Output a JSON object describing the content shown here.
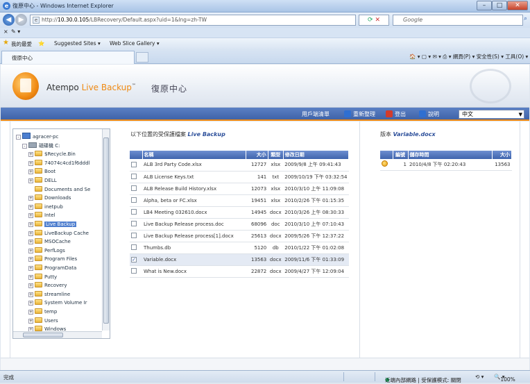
{
  "window": {
    "title": "復原中心 - Windows Internet Explorer",
    "min": "–",
    "max": "□",
    "close": "✕"
  },
  "address": {
    "prefix": "http://",
    "host": "10.30.0.105",
    "path": "/LBRecovery/Default.aspx?uid=1&lng=zh-TW",
    "search_placeholder": "Google",
    "refresh": "✕"
  },
  "menu": {
    "close_x": "×",
    "fav_tool": "✎ ▾"
  },
  "favorites": {
    "label": "我的最愛",
    "suggested": "Suggested Sites ▾",
    "gallery": "Web Slice Gallery ▾"
  },
  "tab": {
    "label": "復原中心"
  },
  "commands": {
    "text": "🏠 ▾  ▢ ▾  ✉ ▾  ⎙ ▾  網頁(P) ▾  安全性(S) ▾  工具(O) ▾  ❓ ▾"
  },
  "app": {
    "brand_main": "Atempo",
    "brand_product": "Live Backup",
    "brand_tm": "™",
    "page_title": "復原中心"
  },
  "toolbar": {
    "client_label": "用戶端清單",
    "refresh_label": "重新整理",
    "logout_label": "登出",
    "help_label": "說明",
    "language": "中文",
    "colors": {
      "refresh": "#2f6fd1",
      "logout": "#d23c2c",
      "help": "#2f6fd1"
    }
  },
  "tree": {
    "items": [
      {
        "label": "agracer-pc",
        "kind": "pc",
        "level": 0,
        "pm": "-"
      },
      {
        "label": "磁碟機 C:",
        "kind": "drive",
        "level": 1,
        "pm": "-"
      },
      {
        "label": "$Recycle.Bin",
        "kind": "folder",
        "level": 2,
        "pm": "+"
      },
      {
        "label": "74074c4cd1f6dddl",
        "kind": "folder",
        "level": 2,
        "pm": "+"
      },
      {
        "label": "Boot",
        "kind": "folder",
        "level": 2,
        "pm": "+"
      },
      {
        "label": "DELL",
        "kind": "folder",
        "level": 2,
        "pm": "+"
      },
      {
        "label": "Documents and Se",
        "kind": "folder",
        "level": 2,
        "pm": ""
      },
      {
        "label": "Downloads",
        "kind": "folder",
        "level": 2,
        "pm": "+"
      },
      {
        "label": "inetpub",
        "kind": "folder",
        "level": 2,
        "pm": "+"
      },
      {
        "label": "Intel",
        "kind": "folder",
        "level": 2,
        "pm": "+"
      },
      {
        "label": "Live Backup",
        "kind": "folder",
        "level": 2,
        "pm": "+",
        "selected": true
      },
      {
        "label": "LiveBackup Cache",
        "kind": "folder",
        "level": 2,
        "pm": "+"
      },
      {
        "label": "MSOCache",
        "kind": "folder",
        "level": 2,
        "pm": "+"
      },
      {
        "label": "PerfLogs",
        "kind": "folder",
        "level": 2,
        "pm": "+"
      },
      {
        "label": "Program Files",
        "kind": "folder",
        "level": 2,
        "pm": "+"
      },
      {
        "label": "ProgramData",
        "kind": "folder",
        "level": 2,
        "pm": "+"
      },
      {
        "label": "Putty",
        "kind": "folder",
        "level": 2,
        "pm": "+"
      },
      {
        "label": "Recovery",
        "kind": "folder",
        "level": 2,
        "pm": "+"
      },
      {
        "label": "streamline",
        "kind": "folder",
        "level": 2,
        "pm": "+"
      },
      {
        "label": "System Volume Ir",
        "kind": "folder",
        "level": 2,
        "pm": "+"
      },
      {
        "label": "temp",
        "kind": "folder",
        "level": 2,
        "pm": "+"
      },
      {
        "label": "Users",
        "kind": "folder",
        "level": 2,
        "pm": "+"
      },
      {
        "label": "Windows",
        "kind": "folder",
        "level": 2,
        "pm": "+"
      }
    ]
  },
  "files": {
    "heading": "以下位置的受保護檔案",
    "location": "Live Backup",
    "columns": [
      "名稱",
      "大小",
      "類型",
      "修改日期"
    ],
    "rows": [
      {
        "name": "ALB 3rd Party Code.xlsx",
        "size": "12727",
        "type": "xlsx",
        "date": "2009/9/8 上午 09:41:43",
        "checked": false
      },
      {
        "name": "ALB License Keys.txt",
        "size": "141",
        "type": "txt",
        "date": "2009/10/19 下午 03:32:54",
        "checked": false
      },
      {
        "name": "ALB Release Build History.xlsx",
        "size": "12073",
        "type": "xlsx",
        "date": "2010/3/10 上午 11:09:08",
        "checked": false
      },
      {
        "name": "Alpha, beta or FC.xlsx",
        "size": "19451",
        "type": "xlsx",
        "date": "2010/2/26 下午 01:15:35",
        "checked": false
      },
      {
        "name": "LB4 Meeting 032610.docx",
        "size": "14945",
        "type": "docx",
        "date": "2010/3/26 上午 08:30:33",
        "checked": false
      },
      {
        "name": "Live Backup Release process.doc",
        "size": "68096",
        "type": "doc",
        "date": "2010/3/10 上午 07:10:43",
        "checked": false
      },
      {
        "name": "Live Backup Release process[1].docx",
        "size": "25613",
        "type": "docx",
        "date": "2009/5/26 下午 12:37:22",
        "checked": false
      },
      {
        "name": "Thumbs.db",
        "size": "5120",
        "type": "db",
        "date": "2010/1/22 下午 01:02:08",
        "checked": false
      },
      {
        "name": "Variable.docx",
        "size": "13563",
        "type": "docx",
        "date": "2009/11/6 下午 01:33:09",
        "checked": true
      },
      {
        "name": "What is New.docx",
        "size": "22872",
        "type": "docx",
        "date": "2009/4/27 下午 12:09:04",
        "checked": false
      }
    ]
  },
  "versions": {
    "heading": "版本",
    "file": "Variable.docx",
    "columns": [
      "編號",
      "儲存時間",
      "大小"
    ],
    "rows": [
      {
        "num": "1",
        "time": "2010/4/8 下午 02:20:43",
        "size": "13563"
      }
    ]
  },
  "status": {
    "left": "完成",
    "zone": "近端內部網路 | 受保護模式: 關閉",
    "zoom": "100%"
  }
}
